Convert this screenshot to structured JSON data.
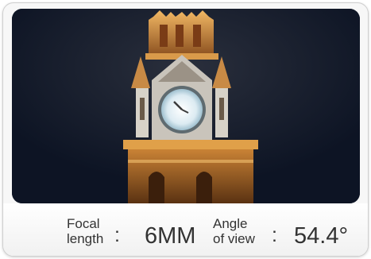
{
  "photo": {
    "icon": "clock-tower-night-photo"
  },
  "specs": {
    "focal": {
      "label_line1": "Focal",
      "label_line2": "length",
      "separator": ":",
      "value": "6MM"
    },
    "angle": {
      "label_line1": "Angle",
      "label_line2": "of view",
      "separator": ":",
      "value": "54.4°"
    }
  },
  "colors": {
    "sky": "#111a2c",
    "tower_light": "#e0a049",
    "clock_face": "#e6f2f7"
  }
}
